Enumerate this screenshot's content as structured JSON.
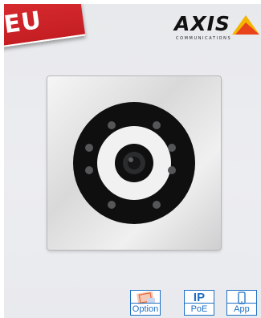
{
  "ribbon": {
    "label": "EU",
    "color": "#c41e23"
  },
  "logo": {
    "wordmark": "AXIS",
    "tagline": "COMMUNICATIONS",
    "triangle_colors": [
      "#f4b400",
      "#e8431b"
    ]
  },
  "product": {
    "icon": "camera-module-icon",
    "led_count": 8
  },
  "badges": [
    {
      "label": "Option",
      "icon": "option-stamp-icon"
    },
    {
      "label": "PoE",
      "icon_text": "IP"
    },
    {
      "label": "App",
      "icon": "smartphone-icon"
    }
  ],
  "colors": {
    "badge_blue": "#1d6fc4",
    "panel_black": "#111111"
  }
}
